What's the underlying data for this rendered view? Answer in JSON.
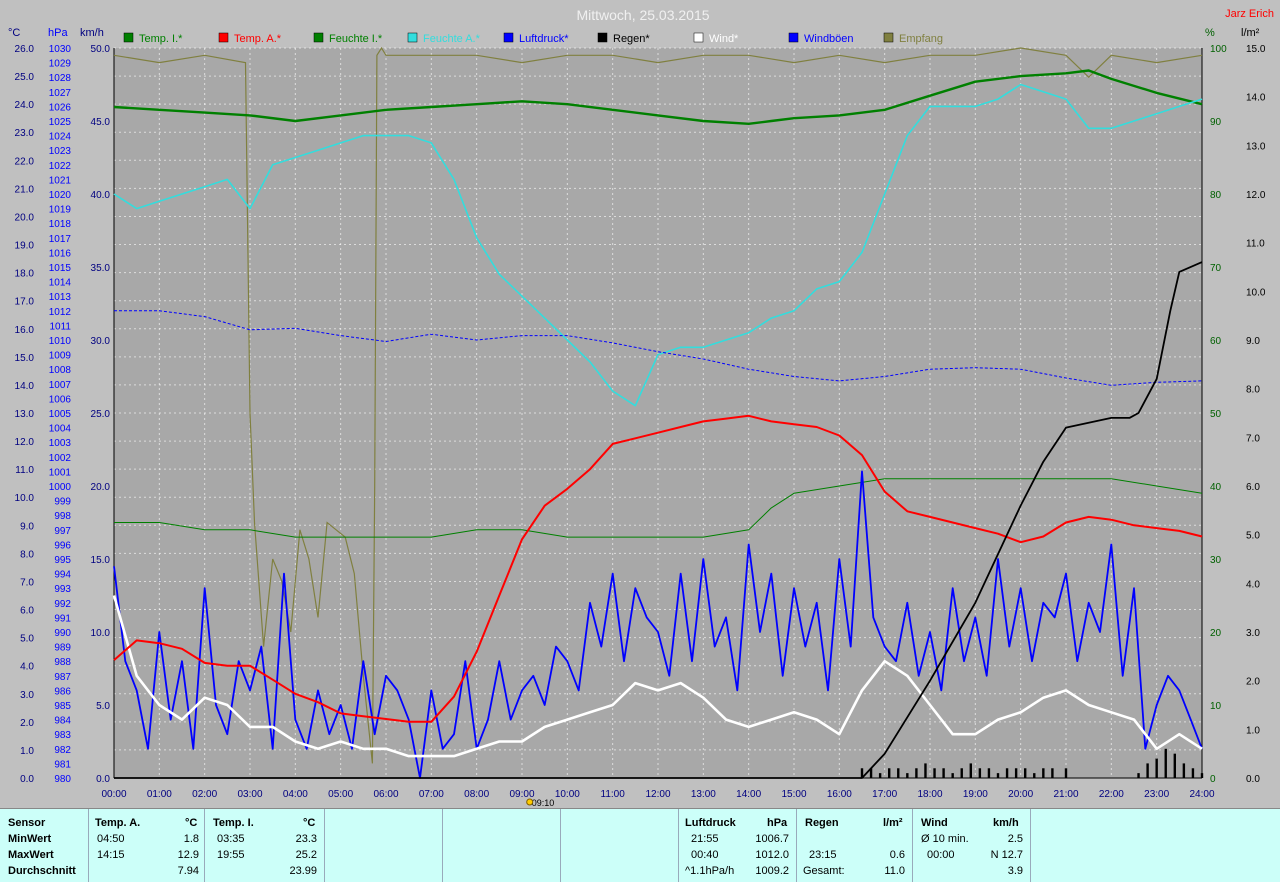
{
  "title": "Mittwoch, 25.03.2015",
  "author": "Jarz Erich",
  "colors": {
    "bg": "#a8a8a8",
    "grid": "#ffffff",
    "temp_in": "#008000",
    "temp_out": "#ff0000",
    "hum_in": "#008000",
    "hum_out": "#33dddd",
    "pressure": "#0000ff",
    "rain": "#000000",
    "wind": "#ffffff",
    "gust": "#0000ff",
    "reception": "#808040"
  },
  "units": {
    "c": "°C",
    "hpa": "hPa",
    "kmh": "km/h",
    "pct": "%",
    "lm2": "l/m²"
  },
  "legend": [
    {
      "label": "Temp. I.*",
      "color": "#008000"
    },
    {
      "label": "Temp. A.*",
      "color": "#ff0000"
    },
    {
      "label": "Feuchte I.*",
      "color": "#008000"
    },
    {
      "label": "Feuchte A.*",
      "color": "#33dddd"
    },
    {
      "label": "Luftdruck*",
      "color": "#0000ff"
    },
    {
      "label": "Regen*",
      "color": "#000000"
    },
    {
      "label": "Wind*",
      "color": "#ffffff"
    },
    {
      "label": "Windböen",
      "color": "#0000ff"
    },
    {
      "label": "Empfang",
      "color": "#808040"
    }
  ],
  "chart_data": {
    "type": "line",
    "title": "Mittwoch, 25.03.2015",
    "x_ticks": [
      "00:00",
      "01:00",
      "02:00",
      "03:00",
      "04:00",
      "05:00",
      "06:00",
      "07:00",
      "08:00",
      "09:00",
      "10:00",
      "11:00",
      "12:00",
      "13:00",
      "14:00",
      "15:00",
      "16:00",
      "17:00",
      "18:00",
      "19:00",
      "20:00",
      "21:00",
      "22:00",
      "23:00",
      "24:00"
    ],
    "marker_label": "09:10",
    "axes": {
      "temp_c": {
        "ylim": [
          0,
          26
        ],
        "ticks": [
          "0.0",
          "1.0",
          "2.0",
          "3.0",
          "4.0",
          "5.0",
          "6.0",
          "7.0",
          "8.0",
          "9.0",
          "10.0",
          "11.0",
          "12.0",
          "13.0",
          "14.0",
          "15.0",
          "16.0",
          "17.0",
          "18.0",
          "19.0",
          "20.0",
          "21.0",
          "22.0",
          "23.0",
          "24.0",
          "25.0",
          "26.0"
        ]
      },
      "pressure_hpa": {
        "ylim": [
          980,
          1030
        ]
      },
      "wind_kmh": {
        "ylim": [
          0,
          50
        ],
        "ticks": [
          "0.0",
          "5.0",
          "10.0",
          "15.0",
          "20.0",
          "25.0",
          "30.0",
          "35.0",
          "40.0",
          "45.0",
          "50.0"
        ]
      },
      "humidity_pct": {
        "ylim": [
          0,
          100
        ],
        "ticks": [
          "0",
          "10",
          "20",
          "30",
          "40",
          "50",
          "60",
          "70",
          "80",
          "90",
          "100"
        ]
      },
      "rain_lm2": {
        "ylim": [
          0,
          15
        ],
        "ticks": [
          "0.0",
          "1.0",
          "2.0",
          "3.0",
          "4.0",
          "5.0",
          "6.0",
          "7.0",
          "8.0",
          "9.0",
          "10.0",
          "11.0",
          "12.0",
          "13.0",
          "14.0",
          "15.0"
        ]
      }
    },
    "series": [
      {
        "name": "Temp. A.*",
        "axis": "temp_c",
        "x": [
          0,
          0.5,
          1,
          1.5,
          2,
          2.5,
          3,
          3.5,
          4,
          4.5,
          5,
          5.5,
          6,
          6.5,
          7,
          7.5,
          8,
          8.5,
          9,
          9.5,
          10,
          10.5,
          11,
          11.5,
          12,
          12.5,
          13,
          13.5,
          14,
          14.5,
          15,
          15.5,
          16,
          16.5,
          17,
          17.5,
          18,
          18.5,
          19,
          19.5,
          20,
          20.5,
          21,
          21.5,
          22,
          22.5,
          23,
          23.5,
          24
        ],
        "values": [
          4.2,
          4.9,
          4.8,
          4.6,
          4.1,
          4.0,
          4.0,
          3.5,
          3.0,
          2.7,
          2.3,
          2.2,
          2.1,
          2.0,
          2.0,
          2.9,
          4.5,
          6.5,
          8.5,
          9.7,
          10.3,
          11.0,
          11.9,
          12.1,
          12.3,
          12.5,
          12.7,
          12.8,
          12.9,
          12.7,
          12.6,
          12.5,
          12.2,
          11.5,
          10.2,
          9.5,
          9.3,
          9.1,
          8.9,
          8.7,
          8.4,
          8.6,
          9.1,
          9.3,
          9.2,
          9.0,
          8.9,
          8.8,
          8.6
        ]
      },
      {
        "name": "Temp. I.*",
        "axis": "temp_c",
        "x": [
          0,
          1,
          2,
          3,
          4,
          5,
          6,
          7,
          8,
          9,
          10,
          11,
          12,
          13,
          14,
          14.5,
          15,
          16,
          17,
          18,
          19,
          20,
          21,
          21.5,
          22,
          23,
          24
        ],
        "values": [
          23.9,
          23.8,
          23.7,
          23.6,
          23.4,
          23.6,
          23.8,
          23.9,
          24.0,
          24.1,
          24.0,
          23.8,
          23.6,
          23.4,
          23.3,
          23.4,
          23.5,
          23.6,
          23.8,
          24.3,
          24.8,
          25.0,
          25.1,
          25.2,
          24.9,
          24.4,
          24.0
        ]
      },
      {
        "name": "Feuchte A.*",
        "axis": "humidity_pct",
        "x": [
          0,
          0.5,
          1,
          1.5,
          2,
          2.5,
          3,
          3.5,
          4,
          4.5,
          5,
          5.5,
          6,
          6.5,
          7,
          7.5,
          8,
          8.5,
          9,
          9.5,
          10,
          10.5,
          11,
          11.5,
          12,
          12.5,
          13,
          13.5,
          14,
          14.5,
          15,
          15.5,
          16,
          16.5,
          17,
          17.5,
          18,
          18.5,
          19,
          19.5,
          20,
          20.5,
          21,
          21.5,
          22,
          22.5,
          23,
          23.5,
          24
        ],
        "values": [
          80,
          78,
          79,
          80,
          81,
          82,
          78,
          84,
          85,
          86,
          87,
          88,
          88,
          88,
          87,
          82,
          74,
          69,
          66,
          63,
          60,
          57,
          53,
          51,
          58,
          59,
          59,
          60,
          61,
          63,
          64,
          67,
          68,
          72,
          80,
          88,
          92,
          92,
          92,
          93,
          95,
          94,
          93,
          89,
          89,
          90,
          91,
          92,
          93
        ]
      },
      {
        "name": "Feuchte I.*",
        "axis": "humidity_pct",
        "x": [
          0,
          1,
          2,
          3,
          4,
          5,
          6,
          7,
          8,
          9,
          10,
          11,
          12,
          13,
          14,
          14.5,
          15,
          16,
          17,
          18,
          19,
          20,
          21,
          22,
          23,
          24
        ],
        "values": [
          35,
          35,
          34,
          34,
          33,
          33,
          33,
          33,
          34,
          34,
          33,
          33,
          33,
          33,
          34,
          37,
          39,
          40,
          41,
          41,
          41,
          41,
          41,
          41,
          40,
          39
        ]
      },
      {
        "name": "Luftdruck*",
        "axis": "pressure_hpa",
        "x": [
          0,
          1,
          2,
          3,
          4,
          5,
          6,
          7,
          8,
          9,
          10,
          11,
          12,
          13,
          14,
          15,
          16,
          17,
          18,
          19,
          20,
          21,
          22,
          23,
          24
        ],
        "values": [
          1012,
          1012,
          1011.6,
          1010.7,
          1010.8,
          1010.3,
          1009.9,
          1010.4,
          1010.0,
          1010.3,
          1010.3,
          1009.8,
          1009.2,
          1008.7,
          1008.0,
          1007.5,
          1007.2,
          1007.5,
          1008.0,
          1008.1,
          1008.0,
          1007.4,
          1006.9,
          1007.1,
          1007.2
        ]
      },
      {
        "name": "Regen*",
        "axis": "rain_lm2",
        "x": [
          0,
          16,
          16.5,
          17,
          18,
          19,
          20,
          20.5,
          21,
          22,
          22.4,
          22.6,
          23,
          23.3,
          23.5,
          24
        ],
        "values": [
          0,
          0,
          0,
          0.5,
          2.0,
          3.6,
          5.6,
          6.5,
          7.2,
          7.4,
          7.4,
          7.5,
          8.2,
          9.6,
          10.4,
          10.6
        ]
      },
      {
        "name": "Wind*",
        "axis": "wind_kmh",
        "x": [
          0,
          0.5,
          1,
          1.5,
          2,
          2.5,
          3,
          3.5,
          4,
          4.5,
          5,
          5.5,
          6,
          6.5,
          7,
          7.5,
          8,
          8.5,
          9,
          9.5,
          10,
          10.5,
          11,
          11.5,
          12,
          12.5,
          13,
          13.5,
          14,
          14.5,
          15,
          15.5,
          16,
          16.5,
          17,
          17.5,
          18,
          18.5,
          19,
          19.5,
          20,
          20.5,
          21,
          21.5,
          22,
          22.5,
          23,
          23.5,
          24
        ],
        "values": [
          12.5,
          7,
          5,
          4,
          5.5,
          5,
          3.5,
          3.5,
          2.5,
          2,
          2.5,
          2,
          2,
          1.5,
          1.5,
          1.5,
          2,
          2.5,
          2.5,
          3.5,
          4,
          4.5,
          5,
          6.5,
          6,
          6.5,
          5.5,
          4,
          3.5,
          4,
          4.5,
          4,
          3,
          6,
          8,
          7,
          5,
          3,
          3,
          4,
          4.5,
          5.5,
          6,
          5,
          4.5,
          4,
          2,
          3,
          2
        ]
      },
      {
        "name": "Windböen",
        "axis": "wind_kmh",
        "x": [
          0,
          0.25,
          0.5,
          0.75,
          1,
          1.25,
          1.5,
          1.75,
          2,
          2.25,
          2.5,
          2.75,
          3,
          3.25,
          3.5,
          3.75,
          4,
          4.25,
          4.5,
          4.75,
          5,
          5.25,
          5.5,
          5.75,
          6,
          6.25,
          6.5,
          6.75,
          7,
          7.25,
          7.5,
          7.75,
          8,
          8.25,
          8.5,
          8.75,
          9,
          9.25,
          9.5,
          9.75,
          10,
          10.25,
          10.5,
          10.75,
          11,
          11.25,
          11.5,
          11.75,
          12,
          12.25,
          12.5,
          12.75,
          13,
          13.25,
          13.5,
          13.75,
          14,
          14.25,
          14.5,
          14.75,
          15,
          15.25,
          15.5,
          15.75,
          16,
          16.25,
          16.5,
          16.75,
          17,
          17.25,
          17.5,
          17.75,
          18,
          18.25,
          18.5,
          18.75,
          19,
          19.25,
          19.5,
          19.75,
          20,
          20.25,
          20.5,
          20.75,
          21,
          21.25,
          21.5,
          21.75,
          22,
          22.25,
          22.5,
          22.75,
          23,
          23.25,
          23.5,
          23.75,
          24
        ],
        "values": [
          14.5,
          8,
          6,
          2,
          10,
          4,
          8,
          2,
          13,
          5,
          3,
          8,
          6,
          9,
          2,
          14,
          4,
          2,
          6,
          3,
          5,
          2,
          8,
          3,
          7,
          6,
          4,
          0,
          6,
          2,
          3,
          8,
          2,
          4,
          8,
          4,
          6,
          7,
          5,
          9,
          8,
          6,
          12,
          9,
          14,
          8,
          13,
          11,
          10,
          7,
          14,
          8,
          15,
          9,
          11,
          6,
          16,
          10,
          14,
          7,
          13,
          9,
          12,
          6,
          15,
          9,
          21,
          11,
          9,
          8,
          12,
          7,
          10,
          6,
          13,
          8,
          11,
          7,
          15,
          9,
          13,
          8,
          12,
          11,
          14,
          8,
          12,
          10,
          16,
          7,
          13,
          2,
          5,
          7,
          6,
          4,
          2
        ]
      }
    ],
    "rain_bars": {
      "x": [
        16.5,
        16.7,
        16.9,
        17.1,
        17.3,
        17.5,
        17.7,
        17.9,
        18.1,
        18.3,
        18.5,
        18.7,
        18.9,
        19.1,
        19.3,
        19.5,
        19.7,
        19.9,
        20.1,
        20.3,
        20.5,
        20.7,
        21.0,
        22.6,
        22.8,
        23.0,
        23.2,
        23.4,
        23.6,
        23.8,
        24.0
      ],
      "values": [
        0.2,
        0.2,
        0.1,
        0.2,
        0.2,
        0.1,
        0.2,
        0.3,
        0.2,
        0.2,
        0.1,
        0.2,
        0.3,
        0.2,
        0.2,
        0.1,
        0.2,
        0.2,
        0.2,
        0.1,
        0.2,
        0.2,
        0.2,
        0.1,
        0.3,
        0.4,
        0.6,
        0.5,
        0.3,
        0.2,
        0.1
      ]
    },
    "reception": {
      "x": [
        0,
        1,
        2,
        2.9,
        3.0,
        3.1,
        3.3,
        3.5,
        3.7,
        3.9,
        4.1,
        4.3,
        4.5,
        4.7,
        4.9,
        5.1,
        5.3,
        5.5,
        5.7,
        5.75,
        5.8,
        5.9,
        6,
        7,
        8,
        9,
        10,
        11,
        12,
        13,
        14,
        15,
        16,
        17,
        18,
        19,
        20,
        21,
        21.5,
        22,
        23,
        24
      ],
      "values": [
        99,
        98,
        99,
        98,
        50,
        35,
        18,
        30,
        27,
        20,
        34,
        30,
        22,
        35,
        34,
        33,
        28,
        14,
        2,
        40,
        99,
        100,
        99,
        99,
        99,
        98,
        99,
        99,
        98,
        99,
        99,
        98,
        99,
        98,
        99,
        99,
        100,
        99,
        96,
        99,
        98,
        99
      ]
    }
  },
  "stats": {
    "labels": {
      "sensor": "Sensor",
      "min": "MinWert",
      "max": "MaxWert",
      "avg": "Durchschnitt"
    },
    "temp_a": {
      "header": "Temp. A.",
      "unit": "°C",
      "min_time": "04:50",
      "min_val": "1.8",
      "max_time": "14:15",
      "max_val": "12.9",
      "avg": "7.94"
    },
    "temp_i": {
      "header": "Temp. I.",
      "unit": "°C",
      "min_time": "03:35",
      "min_val": "23.3",
      "max_time": "19:55",
      "max_val": "25.2",
      "avg": "23.99"
    },
    "pressure": {
      "header": "Luftdruck",
      "unit": "hPa",
      "min_time": "21:55",
      "min_val": "1006.7",
      "max_time": "00:40",
      "max_val": "1012.0",
      "trend": "^1.1hPa/h",
      "avg": "1009.2"
    },
    "rain": {
      "header": "Regen",
      "unit": "l/m²",
      "max_time": "23:15",
      "max_val": "0.6",
      "total_label": "Gesamt:",
      "total": "11.0"
    },
    "wind": {
      "header": "Wind",
      "unit": "km/h",
      "min_time": "Ø 10 min.",
      "min_val": "2.5",
      "max_time": "00:00",
      "max_val": "N 12.7",
      "avg": "3.9"
    }
  }
}
